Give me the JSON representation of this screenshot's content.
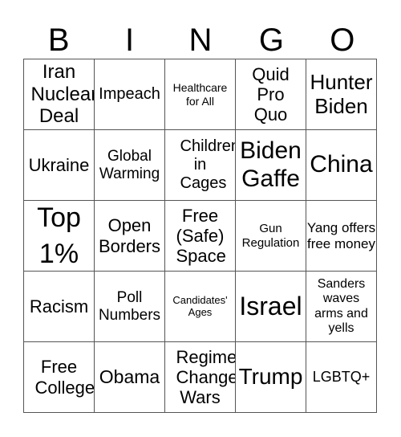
{
  "header": {
    "letters": [
      "B",
      "I",
      "N",
      "G",
      "O"
    ]
  },
  "cells": [
    "Iran Nuclear Deal",
    "Impeach",
    "Healthcare for All",
    "Quid Pro Quo",
    "Hunter Biden",
    "Ukraine",
    "Global Warming",
    "Children in Cages",
    "Biden Gaffe",
    "China",
    "Top 1%",
    "Open Borders",
    "Free (Safe) Space",
    "Gun Regulation",
    "Yang offers free money",
    "Racism",
    "Poll Numbers",
    "Candidates' Ages",
    "Israel",
    "Sanders waves arms and yells",
    "Free College",
    "Obama",
    "Regime Change Wars",
    "Trump",
    "LGBTQ+"
  ]
}
